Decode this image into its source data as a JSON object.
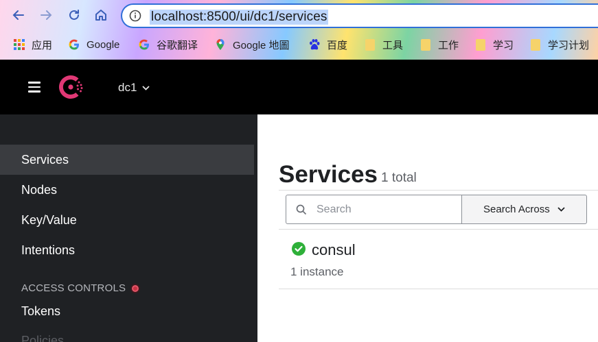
{
  "browser": {
    "url": "localhost:8500/ui/dc1/services",
    "bookmarks": [
      {
        "label": "应用",
        "icon": "apps-grid-icon"
      },
      {
        "label": "Google",
        "icon": "google-icon"
      },
      {
        "label": "谷歌翻译",
        "icon": "google-icon"
      },
      {
        "label": "Google 地圖",
        "icon": "maps-pin-icon"
      },
      {
        "label": "百度",
        "icon": "baidu-paw-icon"
      },
      {
        "label": "工具",
        "icon": "folder-icon"
      },
      {
        "label": "工作",
        "icon": "folder-icon"
      },
      {
        "label": "学习",
        "icon": "folder-icon"
      },
      {
        "label": "学习计划",
        "icon": "folder-icon"
      }
    ]
  },
  "header": {
    "datacenter": "dc1",
    "brand_color": "#e03875"
  },
  "sidebar": {
    "items": [
      {
        "label": "Services"
      },
      {
        "label": "Nodes"
      },
      {
        "label": "Key/Value"
      },
      {
        "label": "Intentions"
      }
    ],
    "access_controls_heading": "ACCESS CONTROLS",
    "access_items": [
      {
        "label": "Tokens"
      },
      {
        "label": "Policies"
      }
    ]
  },
  "main": {
    "title": "Services",
    "count": "1 total",
    "search_placeholder": "Search",
    "search_across_label": "Search Across",
    "services": [
      {
        "name": "consul",
        "instances": "1 instance",
        "status": "passing",
        "status_color": "#2eb039"
      }
    ]
  }
}
